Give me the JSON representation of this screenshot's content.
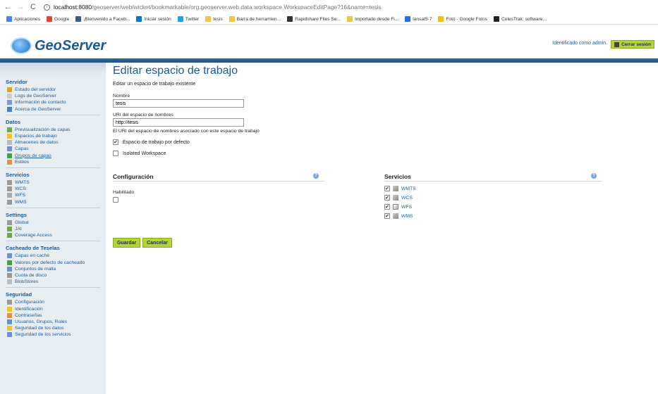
{
  "browser": {
    "url_host": "localhost:8080",
    "url_path": "/geoserver/web/wicket/bookmarkable/org.geoserver.web.data.workspace.WorkspaceEditPage?16&name=tesis",
    "bookmarks": [
      {
        "label": "Aplicaciones",
        "color": "#4285f4"
      },
      {
        "label": "Google",
        "color": "#ea4335"
      },
      {
        "label": "¡Bienvenido a Faceb...",
        "color": "#3b5998"
      },
      {
        "label": "Iniciar sesión",
        "color": "#0078d4"
      },
      {
        "label": "Twitter",
        "color": "#1da1f2"
      },
      {
        "label": "tesis",
        "color": "#f6c344"
      },
      {
        "label": "Barra de herramien...",
        "color": "#f6c344"
      },
      {
        "label": "Rapidshare Files Se...",
        "color": "#333333"
      },
      {
        "label": "Importado desde Fi...",
        "color": "#f6c344"
      },
      {
        "label": "lansat5-7",
        "color": "#1a73e8"
      },
      {
        "label": "Foto - Google Fotos",
        "color": "#fbbc05"
      },
      {
        "label": "CelesTrak: software...",
        "color": "#222222"
      }
    ]
  },
  "header": {
    "logo_text": "GeoServer",
    "logged_in_text": "Identificado como admin.",
    "logout_label": "Cerrar sesión"
  },
  "sidebar": {
    "sections": [
      {
        "title": "Servidor",
        "items": [
          {
            "label": "Estado del servidor",
            "color": "#e0a030"
          },
          {
            "label": "Logs de GeoServer",
            "color": "#cccccc"
          },
          {
            "label": "Información de contacto",
            "color": "#7a9cc6"
          },
          {
            "label": "Acerca de GeoServer",
            "color": "#4a7fc0"
          }
        ]
      },
      {
        "title": "Datos",
        "items": [
          {
            "label": "Previsualización de capas",
            "color": "#6aa84f"
          },
          {
            "label": "Espacios de trabajo",
            "color": "#f1c232"
          },
          {
            "label": "Almacenes de datos",
            "color": "#bbbbbb"
          },
          {
            "label": "Capas",
            "color": "#6d8fc9"
          },
          {
            "label": "Grupos de capas",
            "color": "#4a9a4a"
          },
          {
            "label": "Estilos",
            "color": "#e69138"
          }
        ]
      },
      {
        "title": "Servicios",
        "items": [
          {
            "label": "WMTS",
            "color": "#999999"
          },
          {
            "label": "WCS",
            "color": "#999999"
          },
          {
            "label": "WFS",
            "color": "#aaaaaa"
          },
          {
            "label": "WMS",
            "color": "#999999"
          }
        ]
      },
      {
        "title": "Settings",
        "items": [
          {
            "label": "Global",
            "color": "#999999"
          },
          {
            "label": "JAI",
            "color": "#6aa84f"
          },
          {
            "label": "Coverage Access",
            "color": "#6aa84f"
          }
        ]
      },
      {
        "title": "Cacheado de Teselas",
        "items": [
          {
            "label": "Capas en caché",
            "color": "#6d8fc9"
          },
          {
            "label": "Valores por defecto de cacheado",
            "color": "#4a9a4a"
          },
          {
            "label": "Conjuntos de malla",
            "color": "#6d8fc9"
          },
          {
            "label": "Cuota de disco",
            "color": "#999999"
          },
          {
            "label": "BlobStores",
            "color": "#bbbbbb"
          }
        ]
      },
      {
        "title": "Seguridad",
        "items": [
          {
            "label": "Configuración",
            "color": "#999999"
          },
          {
            "label": "Identificación",
            "color": "#f1c232"
          },
          {
            "label": "Contraseñas",
            "color": "#e69138"
          },
          {
            "label": "Usuarios, Grupos, Roles",
            "color": "#6d8fc9"
          },
          {
            "label": "Seguridad de los datos",
            "color": "#f1c232"
          },
          {
            "label": "Seguridad de los servicios",
            "color": "#6d8fc9"
          }
        ]
      }
    ]
  },
  "main": {
    "title": "Editar espacio de trabajo",
    "subtitle": "Editar un espacio de trabajo existente",
    "name_label": "Nombre",
    "name_value": "tesis",
    "uri_label": "URI del espacio de nombres",
    "uri_value": "http://tesis",
    "uri_help": "El URI del espacio de nombres asociado con este espacio de trabajo",
    "default_label": "Espacio de trabajo por defecto",
    "default_checked": true,
    "isolated_label": "Isolated Workspace",
    "isolated_checked": false,
    "config": {
      "title": "Configuración",
      "enabled_label": "Habilitado",
      "enabled_checked": false
    },
    "services": {
      "title": "Servicios",
      "items": [
        {
          "label": "WMTS",
          "checked": true
        },
        {
          "label": "WCS",
          "checked": true
        },
        {
          "label": "WFS",
          "checked": true
        },
        {
          "label": "WMS",
          "checked": true
        }
      ]
    },
    "save_label": "Guardar",
    "cancel_label": "Cancelar"
  }
}
